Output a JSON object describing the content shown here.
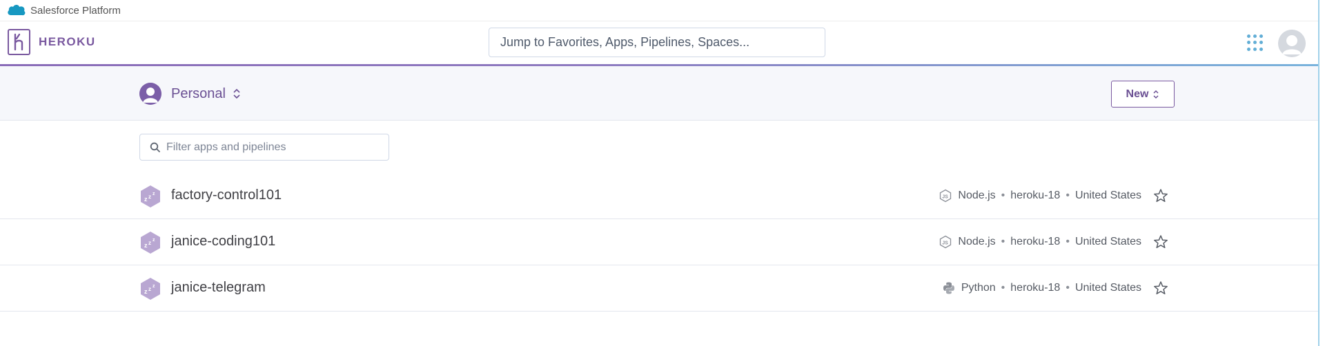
{
  "salesforce_bar": {
    "label": "Salesforce Platform"
  },
  "header": {
    "brand": "HEROKU",
    "search_placeholder": "Jump to Favorites, Apps, Pipelines, Spaces..."
  },
  "subheader": {
    "team": "Personal",
    "new_button": "New"
  },
  "filter": {
    "placeholder": "Filter apps and pipelines"
  },
  "apps": [
    {
      "name": "factory-control101",
      "language": "Node.js",
      "stack": "heroku-18",
      "region": "United States",
      "language_icon": "nodejs-icon"
    },
    {
      "name": "janice-coding101",
      "language": "Node.js",
      "stack": "heroku-18",
      "region": "United States",
      "language_icon": "nodejs-icon"
    },
    {
      "name": "janice-telegram",
      "language": "Python",
      "stack": "heroku-18",
      "region": "United States",
      "language_icon": "python-icon"
    }
  ],
  "colors": {
    "brand_purple": "#79589f",
    "accent_blue": "#62aed6",
    "sleep_hex": "#b9a7d2"
  }
}
